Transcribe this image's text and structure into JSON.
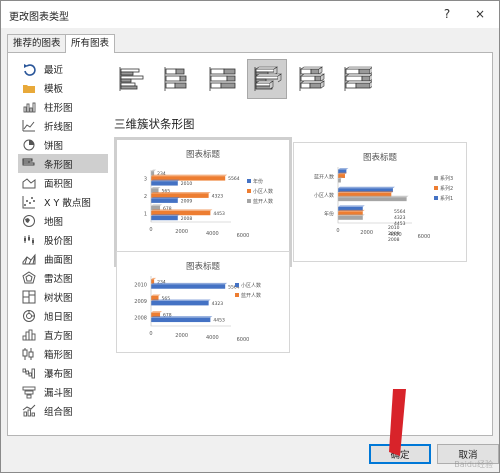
{
  "window": {
    "title": "更改图表类型",
    "help_button": "?",
    "close_button": "×"
  },
  "tabs": [
    {
      "label": "推荐的图表"
    },
    {
      "label": "所有图表"
    }
  ],
  "sidebar": {
    "items": [
      {
        "label": "最近",
        "icon": "recent-icon"
      },
      {
        "label": "模板",
        "icon": "template-folder-icon"
      },
      {
        "label": "柱形图",
        "icon": "column-chart-icon"
      },
      {
        "label": "折线图",
        "icon": "line-chart-icon"
      },
      {
        "label": "饼图",
        "icon": "pie-chart-icon"
      },
      {
        "label": "条形图",
        "icon": "bar-chart-icon",
        "selected": true
      },
      {
        "label": "面积图",
        "icon": "area-chart-icon"
      },
      {
        "label": "X Y 散点图",
        "icon": "scatter-chart-icon"
      },
      {
        "label": "地图",
        "icon": "map-chart-icon"
      },
      {
        "label": "股价图",
        "icon": "stock-chart-icon"
      },
      {
        "label": "曲面图",
        "icon": "surface-chart-icon"
      },
      {
        "label": "雷达图",
        "icon": "radar-chart-icon"
      },
      {
        "label": "树状图",
        "icon": "treemap-chart-icon"
      },
      {
        "label": "旭日图",
        "icon": "sunburst-chart-icon"
      },
      {
        "label": "直方图",
        "icon": "histogram-chart-icon"
      },
      {
        "label": "箱形图",
        "icon": "box-chart-icon"
      },
      {
        "label": "瀑布图",
        "icon": "waterfall-chart-icon"
      },
      {
        "label": "漏斗图",
        "icon": "funnel-chart-icon"
      },
      {
        "label": "组合图",
        "icon": "combo-chart-icon"
      }
    ]
  },
  "subtypes": [
    {
      "name": "clustered-bar"
    },
    {
      "name": "stacked-bar"
    },
    {
      "name": "100-stacked-bar"
    },
    {
      "name": "3d-clustered-bar",
      "selected": true
    },
    {
      "name": "3d-stacked-bar"
    },
    {
      "name": "3d-100-stacked-bar"
    }
  ],
  "section_title": "三维簇状条形图",
  "colors": {
    "blue": "#4472c4",
    "orange": "#ed7d31",
    "gray": "#a5a5a5",
    "selection": "#cfcfcf",
    "accent": "#0078d7",
    "arrow": "#d8232a"
  },
  "previews": [
    {
      "title": "图表标题",
      "categories": [
        "1",
        "2",
        "3"
      ],
      "series": [
        {
          "name": "蓝开人数",
          "color": "gray",
          "values": [
            678,
            565,
            234
          ]
        },
        {
          "name": "小区人数",
          "color": "orange",
          "values": [
            4453,
            4323,
            5564
          ]
        },
        {
          "name": "年份",
          "color": "blue",
          "values": [
            2008,
            2009,
            2010
          ]
        }
      ],
      "x_ticks": [
        "0",
        "2000",
        "4000",
        "6000"
      ]
    },
    {
      "title": "图表标题",
      "categories": [
        "年份",
        "小区人数",
        "蓝开人数"
      ],
      "series": [
        {
          "name": "系列1",
          "color": "blue",
          "values": [
            2008,
            4453,
            678
          ]
        },
        {
          "name": "系列2",
          "color": "orange",
          "values": [
            2009,
            4323,
            565
          ]
        },
        {
          "name": "系列3",
          "color": "gray",
          "values": [
            2010,
            5564,
            234
          ]
        }
      ],
      "bar_labels": [
        "2010",
        "2009",
        "2008",
        "5564",
        "4323",
        "4453"
      ],
      "x_ticks": [
        "0",
        "2000",
        "4000",
        "6000"
      ]
    },
    {
      "title": "图表标题",
      "categories": [
        "2008",
        "2009",
        "2010"
      ],
      "series": [
        {
          "name": "蓝开人数",
          "color": "orange",
          "values": [
            678,
            565,
            234
          ]
        },
        {
          "name": "小区人数",
          "color": "blue",
          "values": [
            4453,
            4323,
            5564
          ]
        }
      ],
      "x_ticks": [
        "0",
        "2000",
        "4000",
        "6000"
      ]
    }
  ],
  "buttons": {
    "ok": "确定",
    "cancel": "取消"
  },
  "watermark": "Baidu经验"
}
